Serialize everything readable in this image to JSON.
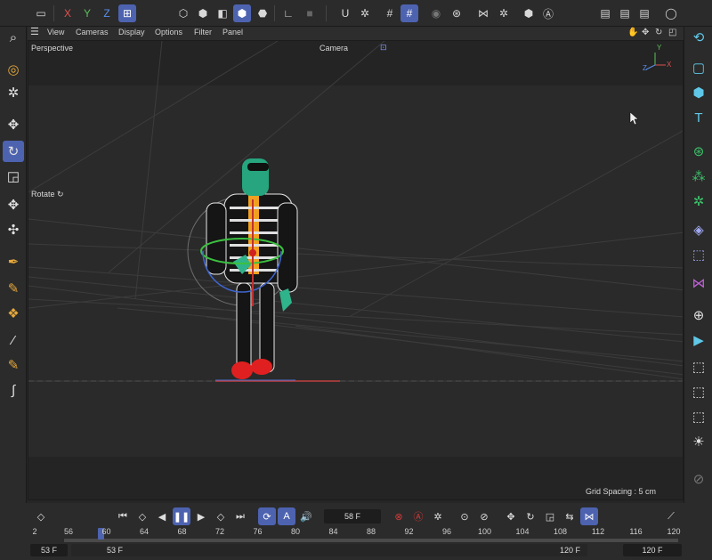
{
  "menu": {
    "items": [
      "View",
      "Cameras",
      "Display",
      "Options",
      "Filter",
      "Panel"
    ]
  },
  "viewport": {
    "name": "Perspective",
    "camera": "Camera",
    "tool_label": "Rotate",
    "grid_spacing": "Grid Spacing : 5 cm",
    "axis_labels": {
      "y": "Y",
      "z": "Z",
      "x": "X"
    }
  },
  "axis_buttons": {
    "x": "X",
    "y": "Y",
    "z": "Z"
  },
  "timeline": {
    "current_frame": "58 F",
    "start_field": "53 F",
    "start_field_2": "53 F",
    "end_field": "120 F",
    "end_field_2": "120 F",
    "ruler_start": "2",
    "ticks": [
      "56",
      "60",
      "64",
      "68",
      "72",
      "76",
      "80",
      "84",
      "88",
      "92",
      "96",
      "100",
      "104",
      "108",
      "112",
      "116",
      "120"
    ],
    "playhead_fraction": 0.06
  },
  "colors": {
    "accent": "#4d63b0",
    "axis_x": "#e05050",
    "axis_y": "#5bc05b",
    "axis_z": "#5a8ee8",
    "record": "#d03a3a",
    "icon_cyan": "#5fc8e8",
    "icon_green": "#3cc36a",
    "icon_purple": "#c060d8"
  }
}
